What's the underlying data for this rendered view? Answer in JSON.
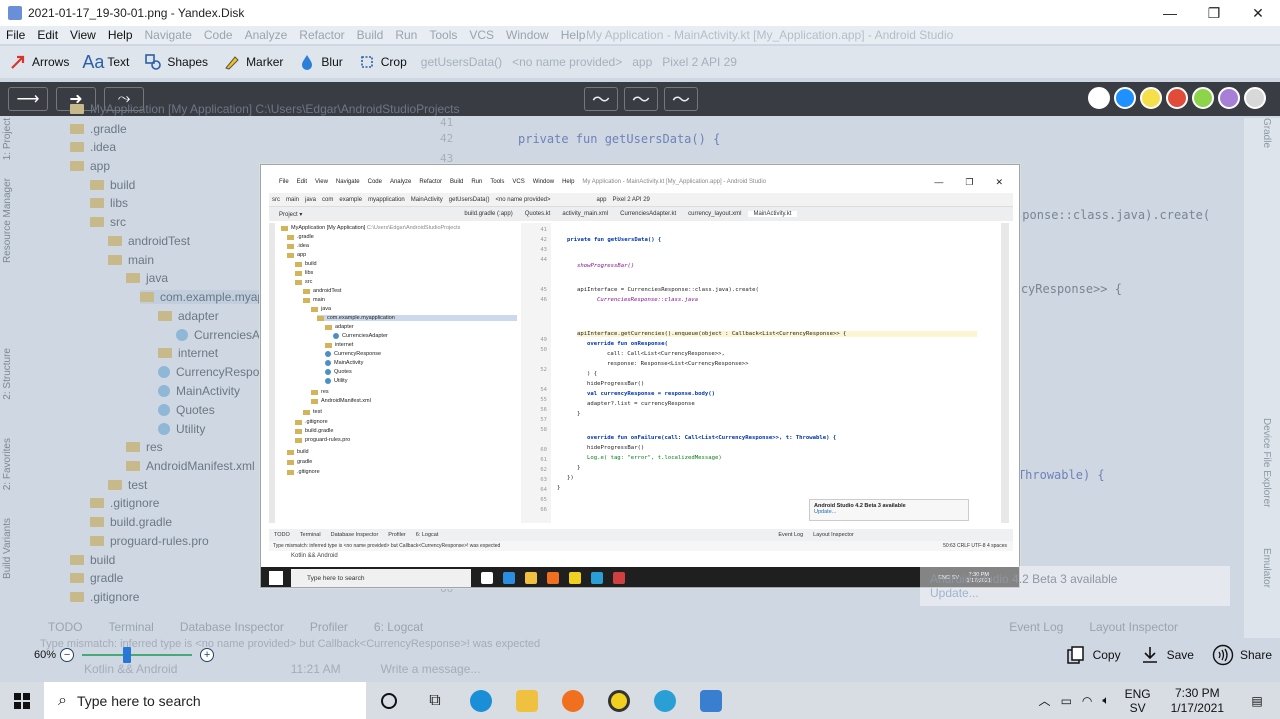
{
  "window": {
    "title": "2021-01-17_19-30-01.png - Yandex.Disk",
    "minimize": "—",
    "maximize": "❐",
    "close": "✕"
  },
  "menu": {
    "items": [
      "File",
      "Edit",
      "View",
      "Help"
    ],
    "ghost_items": [
      "Navigate",
      "Code",
      "Analyze",
      "Refactor",
      "Build",
      "Run",
      "Tools",
      "VCS",
      "Window",
      "Help"
    ],
    "ghost_title": "My Application - MainActivity.kt [My_Application.app] - Android Studio"
  },
  "toolbar": {
    "tools": [
      {
        "label": "Arrows",
        "icon": "arrow-icon"
      },
      {
        "label": "Text",
        "icon": "text-icon"
      },
      {
        "label": "Shapes",
        "icon": "shapes-icon"
      },
      {
        "label": "Marker",
        "icon": "marker-icon"
      },
      {
        "label": "Blur",
        "icon": "blur-icon"
      },
      {
        "label": "Crop",
        "icon": "crop-icon"
      }
    ],
    "ghost_run_config": "app",
    "ghost_device": "Pixel 2 API 29",
    "ghost_no_name": "<no name provided>",
    "ghost_get_users": "getUsersData()"
  },
  "subbar": {
    "swatches": [
      "#ffffff",
      "#1e90ff",
      "#f5e04b",
      "#e04b3a",
      "#8ed44a",
      "#a77fd6",
      "#d8d8d8"
    ]
  },
  "tree": [
    {
      "label": "MyApplication [My Application]",
      "path": "C:\\Users\\Edgar\\AndroidStudioProjects",
      "kind": "folder"
    },
    {
      "label": ".gradle",
      "kind": "folder"
    },
    {
      "label": ".idea",
      "kind": "folder"
    },
    {
      "label": "app",
      "kind": "folder"
    },
    {
      "label": "build",
      "kind": "folder"
    },
    {
      "label": "libs",
      "kind": "folder"
    },
    {
      "label": "src",
      "kind": "folder"
    },
    {
      "label": "androidTest",
      "kind": "folder"
    },
    {
      "label": "main",
      "kind": "folder"
    },
    {
      "label": "java",
      "kind": "folder"
    },
    {
      "label": "com.example.myapplication",
      "kind": "folder"
    },
    {
      "label": "adapter",
      "kind": "folder"
    },
    {
      "label": "CurrenciesAdapter",
      "kind": "class"
    },
    {
      "label": "internet",
      "kind": "folder"
    },
    {
      "label": "CurrencyResponse",
      "kind": "class"
    },
    {
      "label": "MainActivity",
      "kind": "class"
    },
    {
      "label": "Quotes",
      "kind": "class"
    },
    {
      "label": "Utility",
      "kind": "class"
    },
    {
      "label": "res",
      "kind": "folder"
    },
    {
      "label": "AndroidManifest.xml",
      "kind": "file"
    },
    {
      "label": "test",
      "kind": "folder"
    },
    {
      "label": ".gitignore",
      "kind": "file"
    },
    {
      "label": "build.gradle",
      "kind": "file"
    },
    {
      "label": "proguard-rules.pro",
      "kind": "file"
    },
    {
      "label": "build",
      "kind": "folder"
    },
    {
      "label": "gradle",
      "kind": "folder"
    },
    {
      "label": ".gitignore",
      "kind": "file"
    }
  ],
  "side_tabs": [
    "1: Project",
    "Resource Manager",
    "2: Structure",
    "2: Favorites",
    "Build Variants"
  ],
  "right_tabs": [
    "Gradle",
    "Device File Explorer",
    "Emulator"
  ],
  "editor_tabs": [
    "build.gradle (:app)",
    "Quotes.kt",
    "activity_main.xml",
    "CurrenciesAdapter.kt",
    "currency_layout.xml",
    "MainActivity.kt"
  ],
  "code_lines": [
    {
      "n": "41",
      "t": ""
    },
    {
      "n": "42",
      "t": "private fun getUsersData() {"
    },
    {
      "n": "43",
      "t": ""
    },
    {
      "n": "44",
      "t": "    showProgressBar()"
    },
    {
      "n": "45",
      "t": "    apiInterface = CurrenciesResponse::class.java).create("
    },
    {
      "n": "46",
      "t": "        CurrenciesResponse::class.java"
    },
    {
      "n": "49",
      "t": "    apiInterface.getCurrencies().enqueue(object : Callback<List<CurrencyResponse>> {"
    },
    {
      "n": "50",
      "t": "        override fun onResponse("
    },
    {
      "n": "52",
      "t": "            call: Call<List<CurrencyResponse>>,"
    },
    {
      "n": "54",
      "t": "            response: Response<List<CurrencyResponse>>"
    },
    {
      "n": "55",
      "t": "        ) {"
    },
    {
      "n": "56",
      "t": "            hideProgressBar()"
    },
    {
      "n": "57",
      "t": "            val currencyResponse = response.body()"
    },
    {
      "n": "58",
      "t": "            adapter?.list = currencyResponse"
    },
    {
      "n": "60",
      "t": "        }"
    },
    {
      "n": "61",
      "t": "        override fun onFailure(call: Call<List<CurrencyResponse>>, t: Throwable) {"
    },
    {
      "n": "62",
      "t": "            hideProgressBar()"
    },
    {
      "n": "63",
      "t": "            Log.e( tag: \"error\", t.localizedMessage)"
    },
    {
      "n": "64",
      "t": "        }"
    },
    {
      "n": "65",
      "t": "    })"
    },
    {
      "n": "66",
      "t": "}"
    }
  ],
  "bottom_tools": [
    "TODO",
    "Terminal",
    "Database Inspector",
    "Profiler",
    "6: Logcat",
    "Event Log",
    "Layout Inspector"
  ],
  "status_message": "Type mismatch: inferred type is <no name provided> but Callback<CurrencyResponse>! was expected",
  "status_right": "50:63  CRLF  UTF-8  4 spaces",
  "kotlin_label": "Kotlin && Android",
  "kotlin_time": "11:21 AM",
  "write_message": "Write a message...",
  "notification": {
    "title": "Android Studio 4.2 Beta 3 available",
    "link": "Update..."
  },
  "embedded_taskbar": {
    "search": "Type here to search",
    "lang": "ENG SV",
    "time": "7:30 PM",
    "date": "1/17/2021"
  },
  "zoom": {
    "level": "60%",
    "minus": "−",
    "plus": "+",
    "fraction": 0.4
  },
  "actions": [
    {
      "label": "Copy",
      "icon": "copy-icon"
    },
    {
      "label": "Save",
      "icon": "save-icon"
    },
    {
      "label": "Share",
      "icon": "share-icon"
    }
  ],
  "taskbar": {
    "search_placeholder": "Type here to search",
    "lang_top": "ENG",
    "lang_bottom": "SV",
    "time": "7:30 PM",
    "date": "1/17/2021"
  }
}
